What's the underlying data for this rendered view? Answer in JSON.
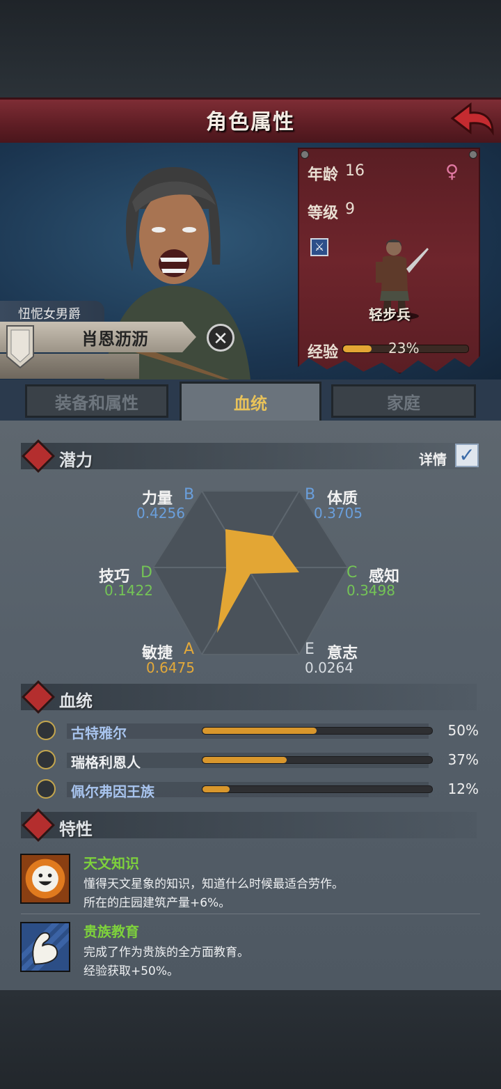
{
  "header": {
    "title": "角色属性"
  },
  "character": {
    "noble_title": "忸怩女男爵",
    "name": "肖恩沥沥"
  },
  "card": {
    "age_label": "年龄",
    "age_value": "16",
    "level_label": "等级",
    "level_value": "9",
    "unit_class": "轻步兵",
    "exp_label": "经验",
    "exp_percent_text": "23%",
    "exp_fraction": 0.23,
    "gender_icon": "female-symbol-icon"
  },
  "tabs": [
    {
      "label": "装备和属性",
      "active": false
    },
    {
      "label": "血统",
      "active": true
    },
    {
      "label": "家庭",
      "active": false
    }
  ],
  "potential": {
    "title": "潜力",
    "details_label": "详情",
    "details_checked": true,
    "attributes": [
      {
        "name": "力量",
        "grade": "B",
        "value": "0.4256",
        "grade_color": "#6a9fdc"
      },
      {
        "name": "体质",
        "grade": "B",
        "value": "0.3705",
        "grade_color": "#6a9fdc"
      },
      {
        "name": "感知",
        "grade": "C",
        "value": "0.3498",
        "grade_color": "#74c456"
      },
      {
        "name": "意志",
        "grade": "E",
        "value": "0.0264",
        "grade_color": "#d8dde2"
      },
      {
        "name": "敏捷",
        "grade": "A",
        "value": "0.6475",
        "grade_color": "#e3a93a"
      },
      {
        "name": "技巧",
        "grade": "D",
        "value": "0.1422",
        "grade_color": "#74c456"
      }
    ]
  },
  "bloodline": {
    "title": "血统",
    "items": [
      {
        "name": "古特雅尔",
        "percent_text": "50%",
        "fraction": 0.5,
        "name_color": "#a8c4ee"
      },
      {
        "name": "瑞格利恩人",
        "percent_text": "37%",
        "fraction": 0.37,
        "name_color": "#eef0f2"
      },
      {
        "name": "佩尔弗因王族",
        "percent_text": "12%",
        "fraction": 0.12,
        "name_color": "#a8c4ee"
      }
    ]
  },
  "traits": {
    "title": "特性",
    "items": [
      {
        "name": "天文知识",
        "line1": "懂得天文星象的知识，知道什么时候最适合劳作。",
        "line2": "所在的庄园建筑产量+6%。",
        "icon": "smiling-sun-icon"
      },
      {
        "name": "贵族教育",
        "line1": "完成了作为贵族的全方面教育。",
        "line2": "经验获取+50%。",
        "icon": "flexed-arm-icon"
      }
    ]
  },
  "colors": {
    "accent_gold": "#e3a634",
    "title_red": "#7e2d35",
    "trait_green": "#7ed23c"
  }
}
